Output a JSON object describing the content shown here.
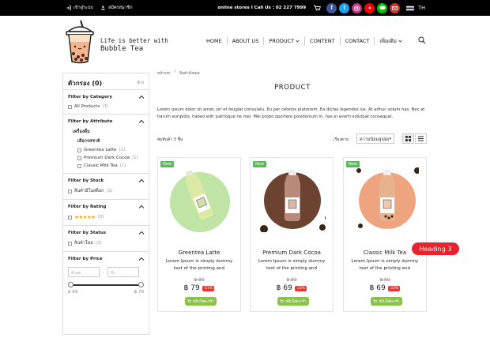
{
  "topbar": {
    "login": "เข้าสู่ระบบ",
    "register": "สมัครสมาชิก",
    "stores": "online stores I Call Us : 02 227 7999",
    "social": [
      "facebook-icon",
      "twitter-icon",
      "instagram-icon",
      "youtube-icon",
      "line-icon",
      "mail-icon"
    ],
    "social_colors": [
      "#3b5998",
      "#1da1f2",
      "#c13584",
      "#ff0000",
      "#00c300",
      "#d93025"
    ],
    "lang": "TH"
  },
  "header": {
    "tagline_1": "Life is better with",
    "tagline_2": "Bubble Tea",
    "nav": [
      "HOME",
      "ABOUT US",
      "PRODUCT",
      "CONTENT",
      "CONTACT",
      "เพิ่มเติม"
    ]
  },
  "sidebar": {
    "title": "ตัวกรอง (0)",
    "clear": "ล้าง",
    "category": {
      "title": "Filter by Category",
      "options": [
        {
          "label": "All Products",
          "count": "(3)"
        }
      ]
    },
    "attribute": {
      "title": "Filter by Attribute",
      "group": "เครื่องดื่ม",
      "subgroup": "เลือกรสชาติ",
      "options": [
        {
          "label": "Greentea Latte",
          "count": "(1)"
        },
        {
          "label": "Premium Dark Cocoa",
          "count": "(1)"
        },
        {
          "label": "Classic Milk Tea",
          "count": "(1)"
        }
      ]
    },
    "stock": {
      "title": "Filter by Stock",
      "options": [
        {
          "label": "สินค้ามีในสต็อก",
          "count": "(3)"
        }
      ]
    },
    "rating": {
      "title": "Filter by Rating",
      "stars": "★★★★★",
      "count": "(3)"
    },
    "status": {
      "title": "Filter by Status",
      "options": [
        {
          "label": "สินค้าใหม่",
          "count": "(3)"
        }
      ]
    },
    "price": {
      "title": "Filter by Price",
      "min_placeholder": "ต่ำสุด",
      "max_placeholder": "ถึง",
      "sep": "-",
      "min": "฿ 69",
      "max": "฿ 79"
    }
  },
  "main": {
    "breadcrumb": [
      "หน้าแรก",
      "/",
      "สินค้าทั้งหมด"
    ],
    "title": "PRODUCT",
    "intro": "Lorem ipsum dolor sit amet, pri et feugiat consulatu. Eu per ceteros platonem. Ea dictas legendos ius. At adhuc solum has. Nec at harum euripidis, habeo elitr patrioque ne mel. Mei probo oportere posidonium in, has ei everti volutpat consequat.",
    "count": "พบสินค้า 3 ชิ้น",
    "sort_label": "เรียงตาม",
    "sort_value": "ความนิยมสูงสุด"
  },
  "products": [
    {
      "badge": "New",
      "name": "Greentea Latte",
      "desc": "Lorem Ipsum is simply dummy text of the printing and",
      "old_price": "฿ 89",
      "price": "฿ 79",
      "discount": "-11%",
      "button": "หยิบใส่ตะกร้า",
      "circle": "#bfe4a5",
      "bottle": "#dbe9a3"
    },
    {
      "badge": "New",
      "name": "Premium Dark Cocoa",
      "desc": "Lorem Ipsum is simply dummy text of the printing and",
      "old_price": "฿ 89",
      "price": "฿ 69",
      "discount": "-22%",
      "button": "หยิบใส่ตะกร้า",
      "circle": "#6b4330",
      "bottle": "#b98a7a"
    },
    {
      "badge": "New",
      "name": "Classic Milk Tea",
      "desc": "Lorem Ipsum is simply dummy text of the printing and",
      "old_price": "฿ 89",
      "price": "฿ 69",
      "discount": "-22%",
      "button": "หยิบใส่ตะกร้า",
      "circle": "#eea57f",
      "bottle": "#e7b38c"
    }
  ],
  "overlay": {
    "heading_tag": "Heading 3"
  }
}
